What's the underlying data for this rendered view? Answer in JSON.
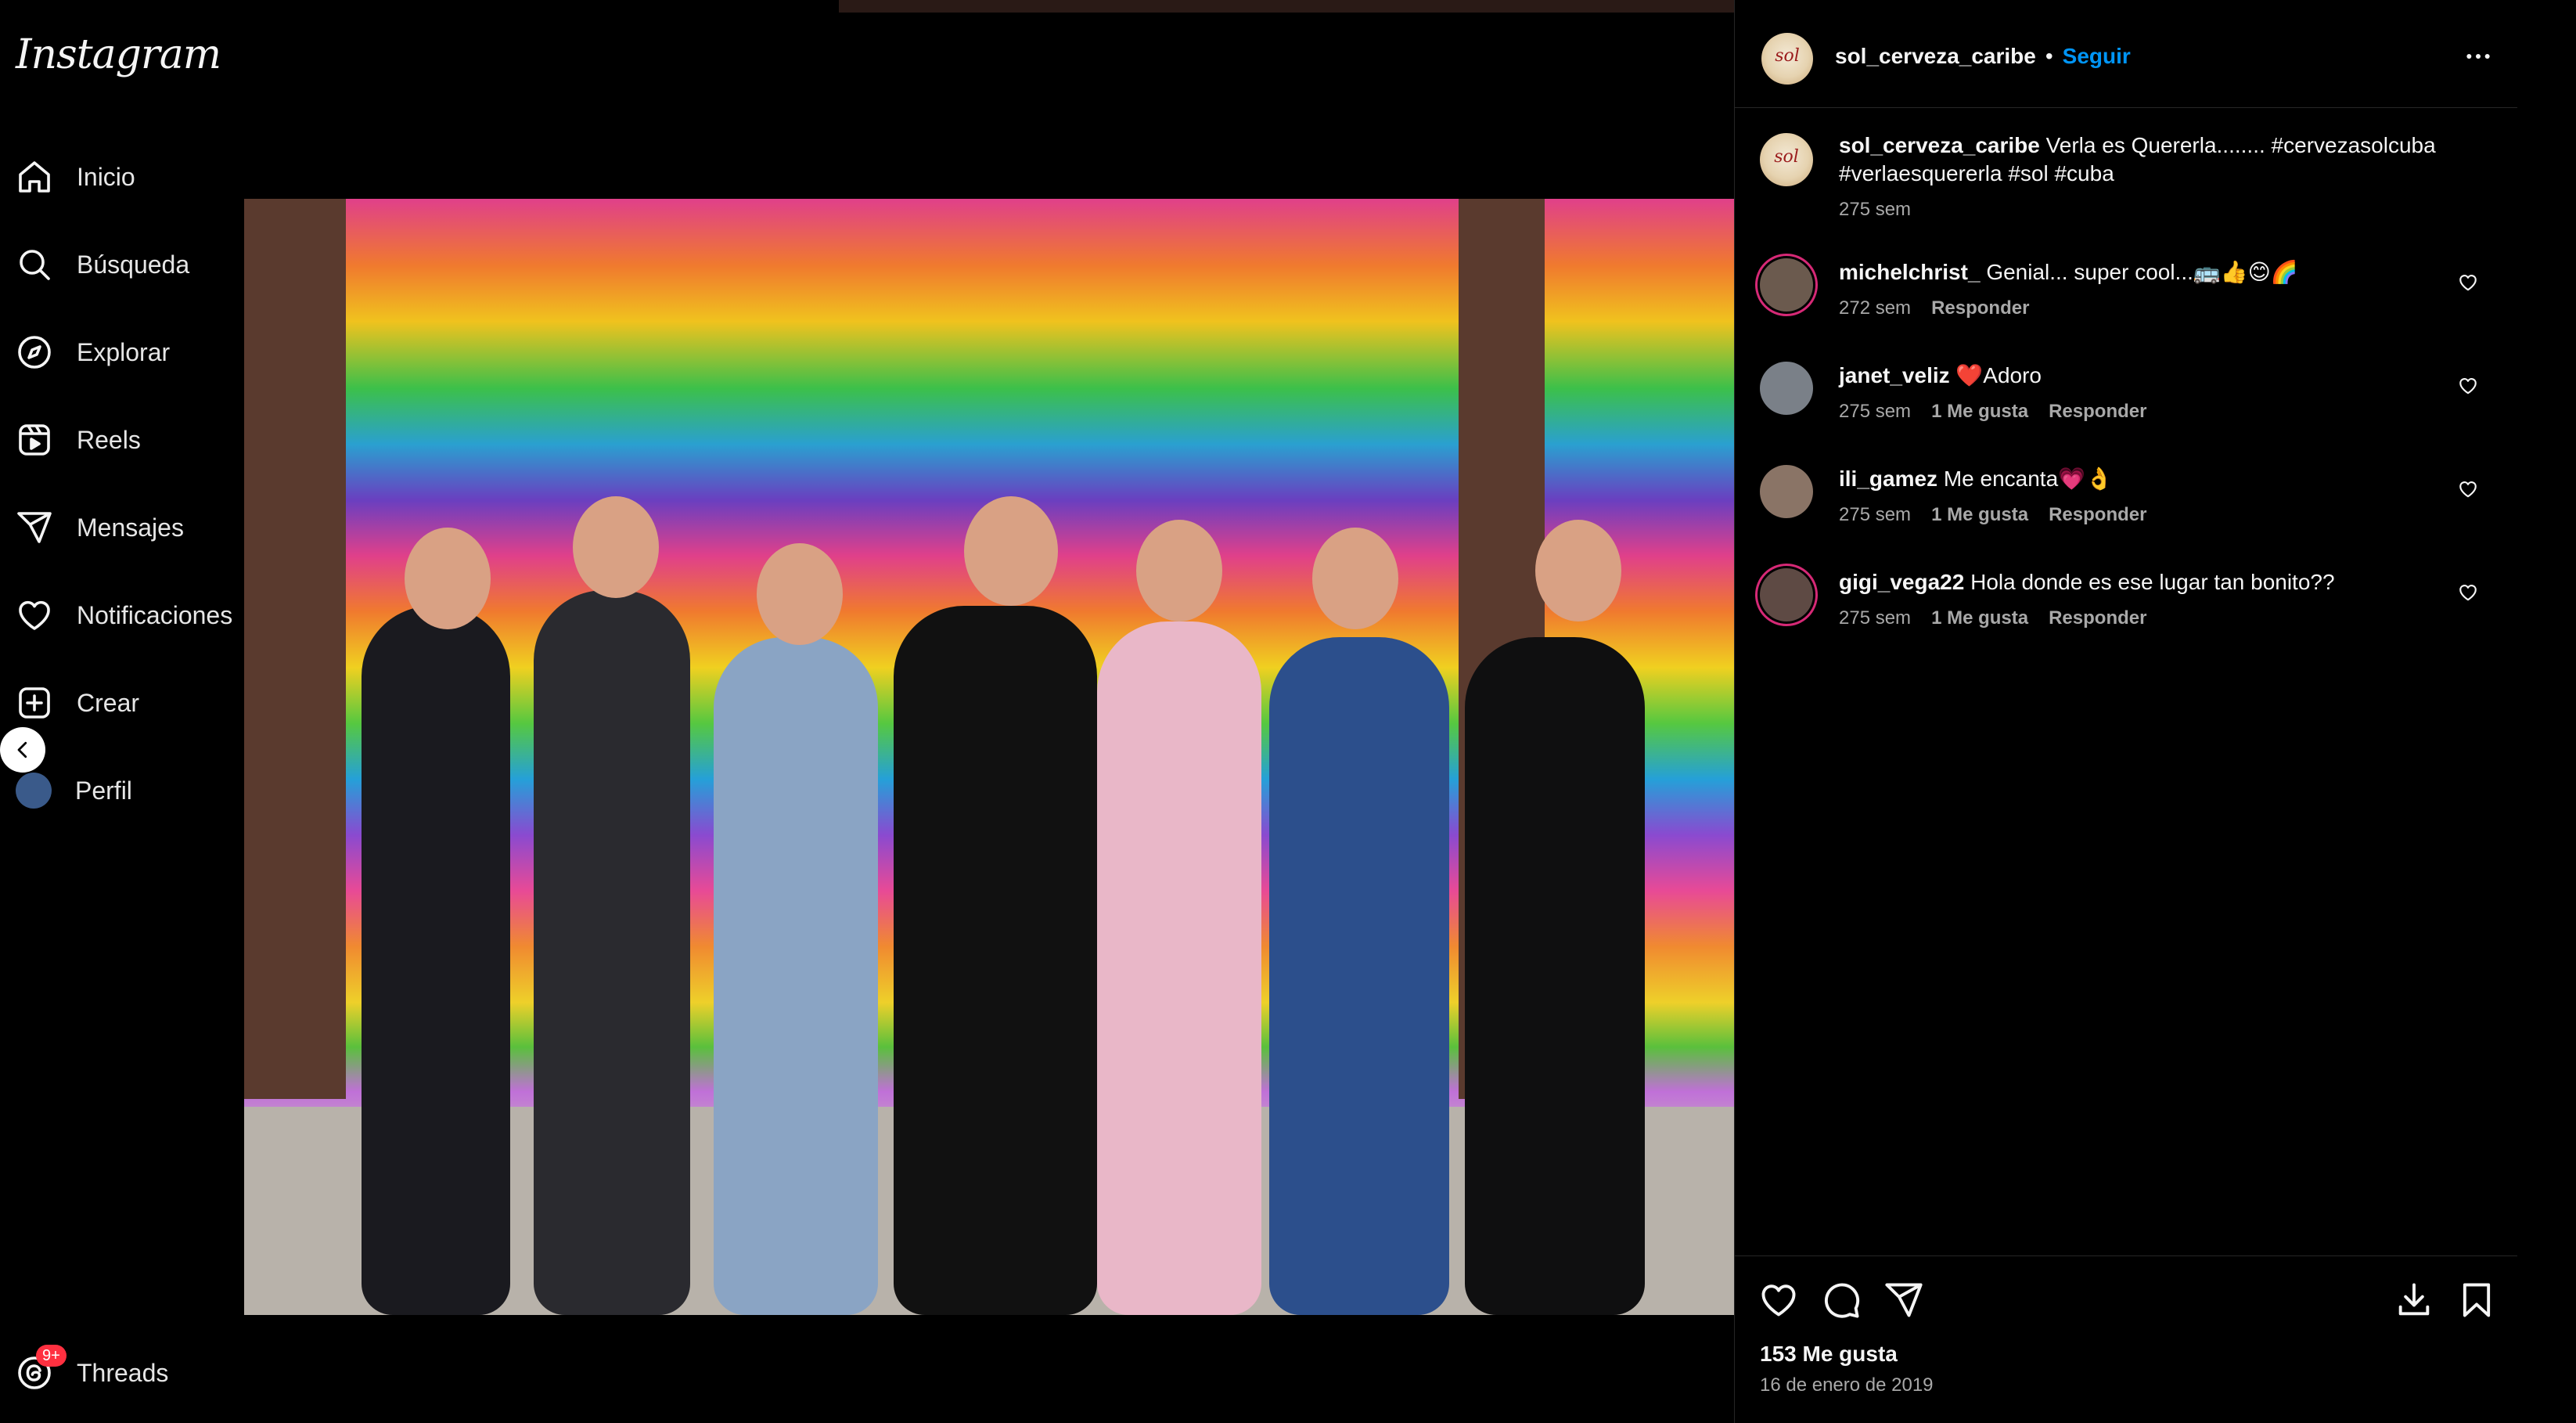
{
  "app": {
    "logo": "Instagram"
  },
  "sidebar": {
    "items": [
      {
        "label": "Inicio",
        "icon": "home-icon"
      },
      {
        "label": "Búsqueda",
        "icon": "search-icon"
      },
      {
        "label": "Explorar",
        "icon": "compass-icon"
      },
      {
        "label": "Reels",
        "icon": "reels-icon"
      },
      {
        "label": "Mensajes",
        "icon": "send-icon"
      },
      {
        "label": "Notificaciones",
        "icon": "heart-icon"
      },
      {
        "label": "Crear",
        "icon": "plus-square-icon"
      },
      {
        "label": "Perfil",
        "icon": "avatar"
      }
    ],
    "threads": {
      "label": "Threads",
      "badge": "9+"
    }
  },
  "post": {
    "author": "sol_cerveza_caribe",
    "follow_label": "Seguir",
    "separator": "•",
    "avatar_text": "sol",
    "caption": {
      "username": "sol_cerveza_caribe",
      "text": "Verla es Quererla........ #cervezasolcuba #verlaesquererla #sol #cuba",
      "time": "275 sem"
    },
    "comments": [
      {
        "username": "michelchrist_",
        "text": "Genial... super cool...🚌👍😊🌈",
        "time": "272 sem",
        "likes": "",
        "reply": "Responder",
        "avatar_color": "#6b5a4e",
        "ring": true
      },
      {
        "username": "janet_veliz",
        "text": "❤️Adoro",
        "time": "275 sem",
        "likes": "1 Me gusta",
        "reply": "Responder",
        "avatar_color": "#7a8088",
        "ring": false
      },
      {
        "username": "ili_gamez",
        "text": "Me encanta💗👌",
        "time": "275 sem",
        "likes": "1 Me gusta",
        "reply": "Responder",
        "avatar_color": "#8a7466",
        "ring": false
      },
      {
        "username": "gigi_vega22",
        "text": "Hola donde es ese lugar tan bonito??",
        "time": "275 sem",
        "likes": "1 Me gusta",
        "reply": "Responder",
        "avatar_color": "#5e4a44",
        "ring": true
      }
    ],
    "likes": "153 Me gusta",
    "date": "16 de enero de 2019"
  },
  "colors": {
    "accent": "#0095f6",
    "background": "#000000",
    "text_secondary": "#a8a8a8",
    "badge": "#ff3040"
  }
}
